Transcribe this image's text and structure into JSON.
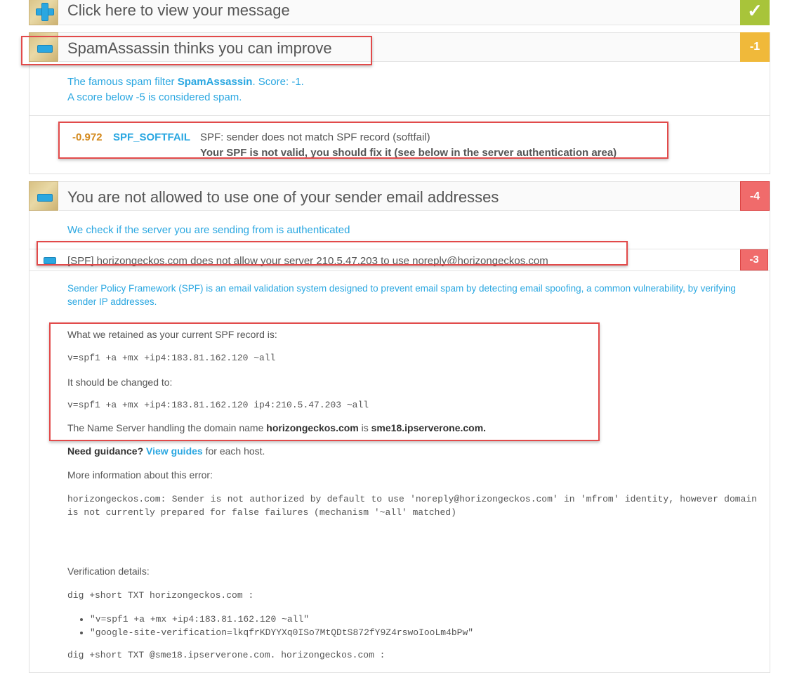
{
  "view_message": {
    "title": "Click here to view your message",
    "check_icon": "checkmark-icon"
  },
  "spamassassin": {
    "title": "SpamAssassin thinks you can improve",
    "score": "-1",
    "intro_pre": "The famous spam filter ",
    "intro_name": "SpamAssassin",
    "intro_post": ". Score: -1.",
    "intro_line2": "A score below -5 is considered spam.",
    "rule": {
      "score": "-0.972",
      "name": "SPF_SOFTFAIL",
      "desc": "SPF: sender does not match SPF record (softfail)",
      "advice": "Your SPF is not valid, you should fix it (see below in the server authentication area)"
    }
  },
  "auth": {
    "title": "You are not allowed to use one of your sender email addresses",
    "score": "-4",
    "intro": "We check if the server you are sending from is authenticated",
    "spf": {
      "title": "[SPF] horizongeckos.com does not allow your server 210.5.47.203 to use noreply@horizongeckos.com",
      "score": "-3",
      "desc": "Sender Policy Framework (SPF) is an email validation system designed to prevent email spam by detecting email spoofing, a common vulnerability, by verifying sender IP addresses.",
      "retained_label": "What we retained as your current SPF record is:",
      "retained_record": "v=spf1 +a +mx +ip4:183.81.162.120 ~all",
      "change_label": "It should be changed to:",
      "change_record": "v=spf1 +a +mx +ip4:183.81.162.120 ip4:210.5.47.203 ~all",
      "ns_pre": "The Name Server handling the domain name ",
      "ns_domain": "horizongeckos.com",
      "ns_mid": " is ",
      "ns_server": "sme18.ipserverone.com.",
      "guidance_bold": "Need guidance?",
      "guidance_link": "View guides",
      "guidance_post": " for each host.",
      "more_info": "More information about this error:",
      "error_text": "horizongeckos.com: Sender is not authorized by default to use 'noreply@horizongeckos.com' in 'mfrom' identity, however domain is not currently prepared for false failures (mechanism '~all' matched)",
      "verification": "Verification details:",
      "dig1": "dig +short TXT horizongeckos.com :",
      "dig1_results": [
        "\"v=spf1 +a +mx +ip4:183.81.162.120 ~all\"",
        "\"google-site-verification=lkqfrKDYYXq0ISo7MtQDtS872fY9Z4rswoIooLm4bPw\""
      ],
      "dig2": "dig +short TXT @sme18.ipserverone.com. horizongeckos.com :"
    }
  },
  "colors": {
    "accent": "#2aa7e1",
    "orange": "#f0b93a",
    "red": "#f06b6b",
    "green": "#a8c43a",
    "highlight": "#e24a4a",
    "score_orange": "#d48a1e"
  }
}
